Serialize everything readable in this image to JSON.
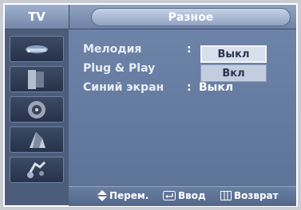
{
  "header": {
    "source_tab": "TV",
    "menu_title": "Разное"
  },
  "sidebar": {
    "icons": [
      {
        "name": "picture-icon"
      },
      {
        "name": "sound-icon"
      },
      {
        "name": "channel-icon"
      },
      {
        "name": "setup-icon"
      },
      {
        "name": "input-icon"
      }
    ]
  },
  "menu": {
    "rows": [
      {
        "label": "Мелодия",
        "colon": ":",
        "value": ""
      },
      {
        "label": "Plug & Play",
        "colon": "",
        "value": ""
      },
      {
        "label": "Синий экран",
        "colon": ":",
        "value": "Выкл"
      }
    ],
    "dropdown": {
      "options": [
        "Выкл",
        "Вкл"
      ],
      "selected": "Выкл"
    }
  },
  "footer": {
    "move": "Перем.",
    "enter": "Ввод",
    "return": "Возврат"
  },
  "colors": {
    "frame": "#5b6f8f",
    "panel": "#6d83a8",
    "highlight": "#d8e0ec"
  }
}
